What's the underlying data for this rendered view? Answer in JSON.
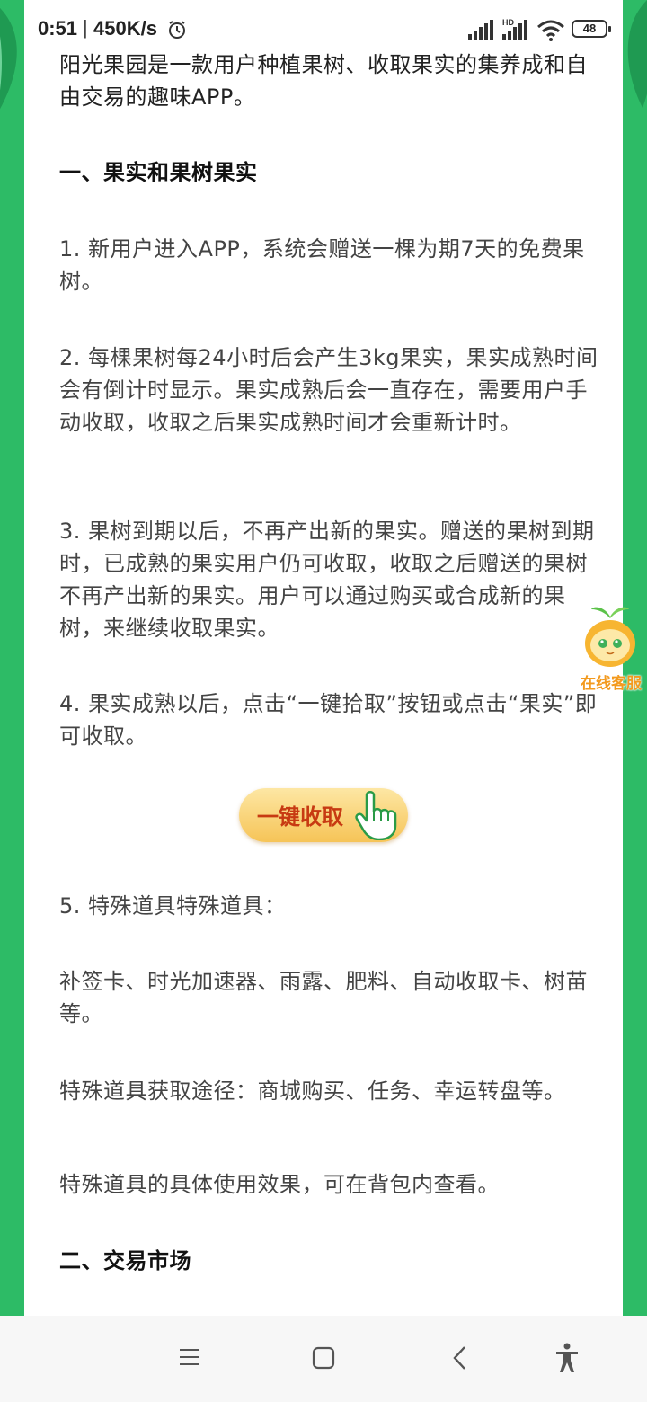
{
  "status_bar": {
    "time": "0:51",
    "separator": "|",
    "net_speed": "450K/s",
    "battery": "48",
    "hd_badge": "HD"
  },
  "article": {
    "intro": "阳光果园是一款用户种植果树、收取果实的集养成和自由交易的趣味APP。",
    "section1_title": "一、果实和果树果实",
    "p1": "1. 新用户进入APP，系统会赠送一棵为期7天的免费果树。",
    "p2": "2. 每棵果树每24小时后会产生3kg果实，果实成熟时间会有倒计时显示。果实成熟后会一直存在，需要用户手动收取，收取之后果实成熟时间才会重新计时。",
    "p3": "3. 果树到期以后，不再产出新的果实。赠送的果树到期时，已成熟的果实用户仍可收取，收取之后赠送的果树不再产出新的果实。用户可以通过购买或合成新的果树，来继续收取果实。",
    "p4": "4. 果实成熟以后，点击“一键拾取”按钮或点击“果实”即可收取。",
    "collect_button_label": "一键收取",
    "p5": "5. 特殊道具特殊道具：",
    "p6": "补签卡、时光加速器、雨露、肥料、自动收取卡、树苗等。",
    "p7": "特殊道具获取途径：商城购买、任务、幸运转盘等。",
    "p8": "特殊道具的具体使用效果，可在背包内查看。",
    "section2_title": "二、交易市场"
  },
  "customer_service": {
    "label": "在线客服"
  },
  "colors": {
    "frame_green": "#2dbb66",
    "button_text": "#c73a12",
    "service_orange": "#f39a1e"
  },
  "icons": {
    "alarm": "alarm-icon",
    "signal": "signal-icon",
    "wifi": "wifi-icon",
    "hand": "hand-pointer-icon",
    "mascot": "fruit-mascot-icon",
    "nav_menu": "menu-icon",
    "nav_home": "home-square-icon",
    "nav_back": "back-chevron-icon",
    "nav_accessibility": "accessibility-icon"
  }
}
